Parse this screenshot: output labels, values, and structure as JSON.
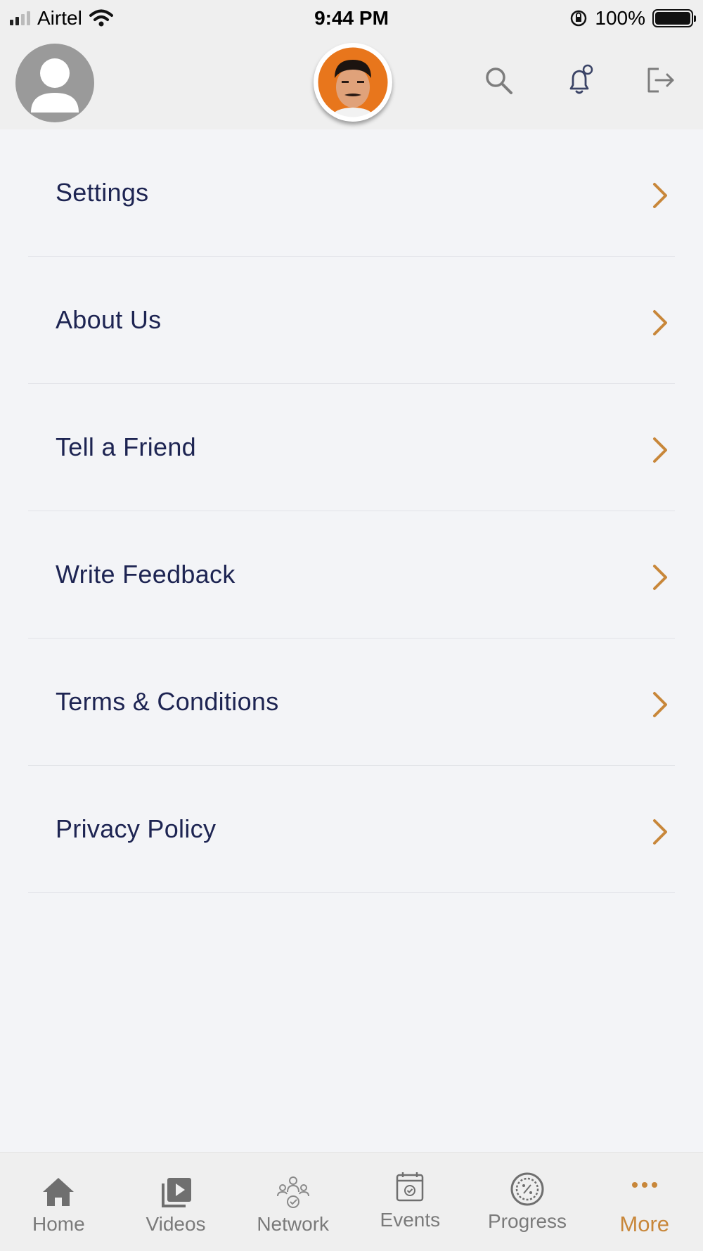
{
  "status_bar": {
    "carrier": "Airtel",
    "time": "9:44 PM",
    "battery": "100%"
  },
  "header": {
    "icons": [
      "user-avatar",
      "brand-logo",
      "search-icon",
      "bell-icon",
      "logout-icon"
    ]
  },
  "menu": {
    "items": [
      {
        "label": "Settings"
      },
      {
        "label": "About Us"
      },
      {
        "label": "Tell a Friend"
      },
      {
        "label": "Write Feedback"
      },
      {
        "label": "Terms & Conditions"
      },
      {
        "label": "Privacy Policy"
      }
    ]
  },
  "tab_bar": {
    "tabs": [
      {
        "label": "Home",
        "icon": "home-icon"
      },
      {
        "label": "Videos",
        "icon": "videos-icon"
      },
      {
        "label": "Network",
        "icon": "network-icon"
      },
      {
        "label": "Events",
        "icon": "calendar-icon"
      },
      {
        "label": "Progress",
        "icon": "progress-icon"
      },
      {
        "label": "More",
        "icon": "more-icon"
      }
    ],
    "active": "More"
  },
  "colors": {
    "accent": "#c8873a",
    "menu_text": "#1d2452",
    "background": "#f3f4f7",
    "header_bg": "#efefef"
  }
}
